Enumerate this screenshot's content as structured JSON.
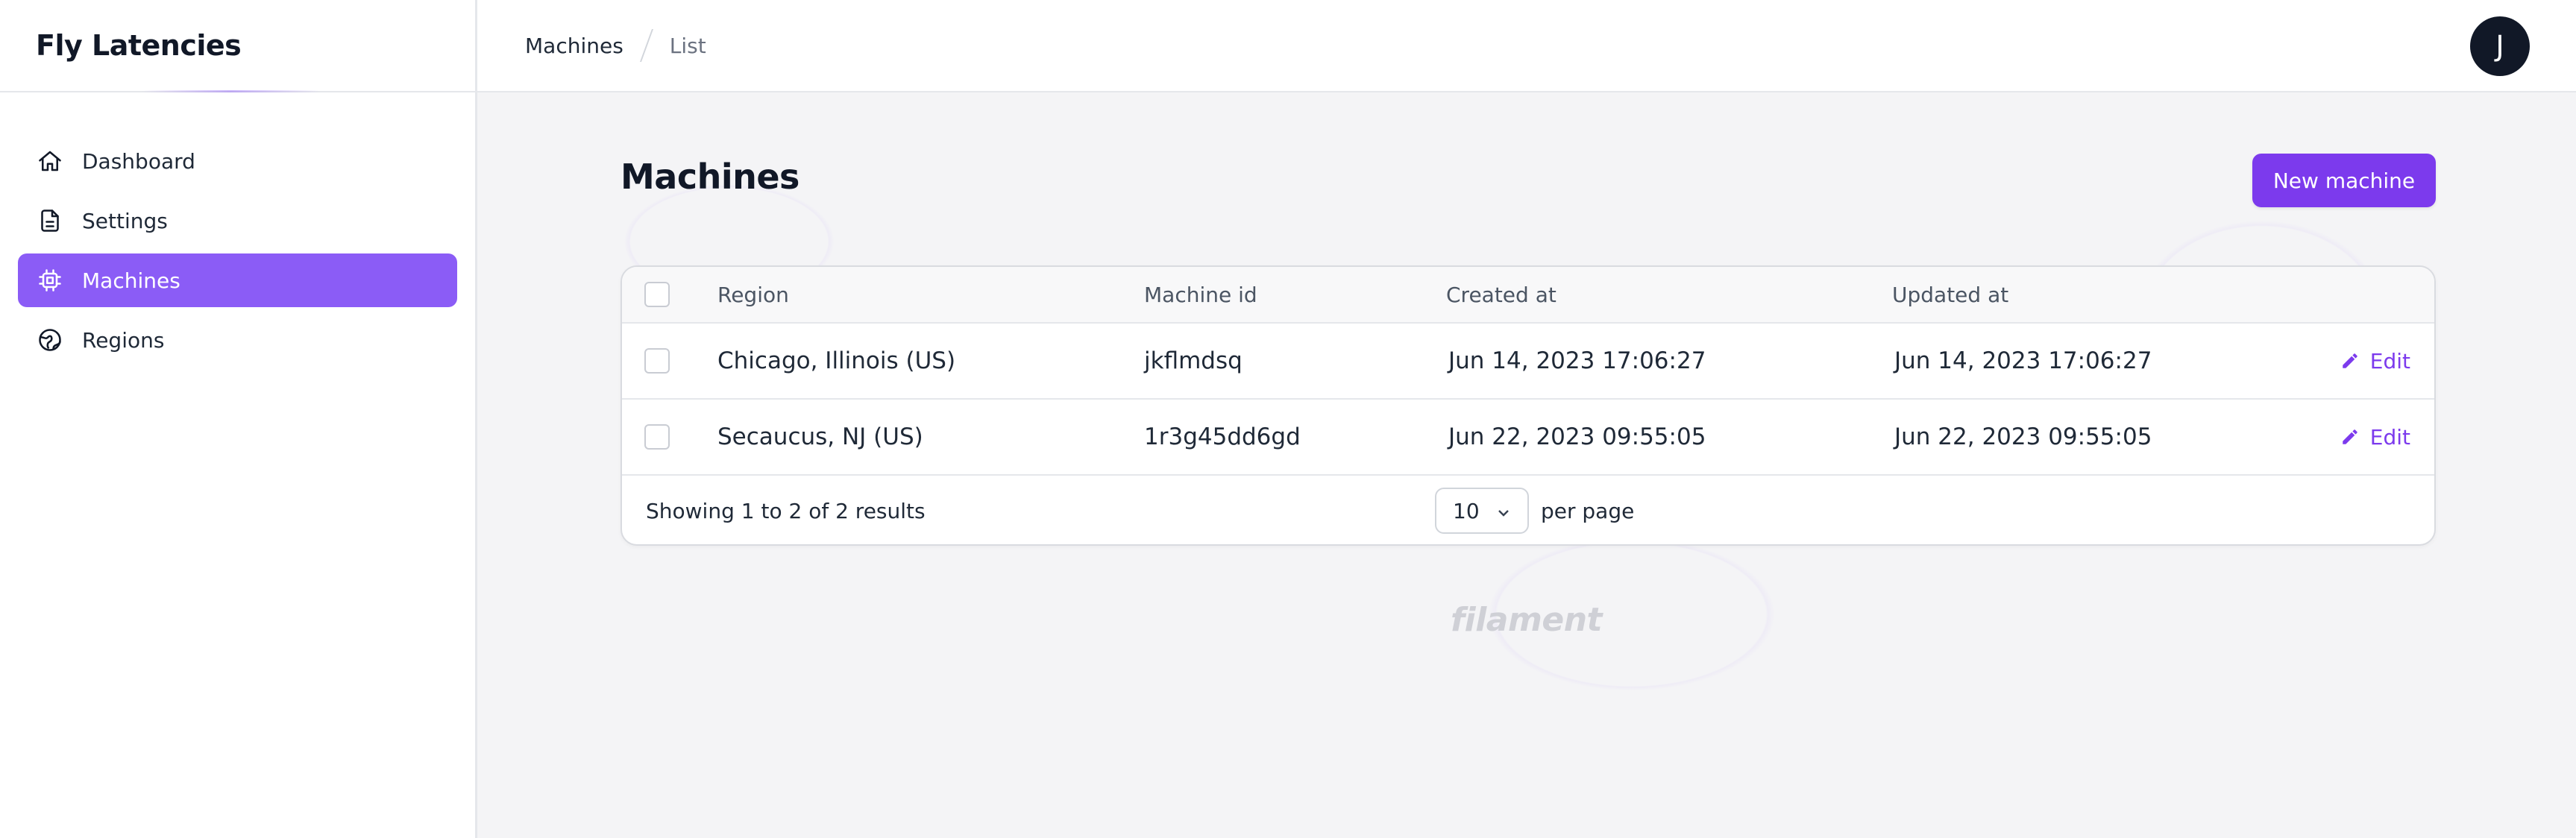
{
  "sidebar": {
    "brand": "Fly Latencies",
    "items": [
      {
        "label": "Dashboard",
        "icon": "home-icon",
        "active": false
      },
      {
        "label": "Settings",
        "icon": "document-icon",
        "active": false
      },
      {
        "label": "Machines",
        "icon": "cpu-chip-icon",
        "active": true
      },
      {
        "label": "Regions",
        "icon": "globe-icon",
        "active": false
      }
    ]
  },
  "topbar": {
    "breadcrumb": [
      "Machines",
      "List"
    ],
    "avatar_initial": "J"
  },
  "main": {
    "title": "Machines",
    "new_button": "New machine",
    "table": {
      "columns": [
        "Region",
        "Machine id",
        "Created at",
        "Updated at"
      ],
      "rows": [
        {
          "region": "Chicago, Illinois (US)",
          "machine_id": "jkflmdsq",
          "created_at": "Jun 14, 2023 17:06:27",
          "updated_at": "Jun 14, 2023 17:06:27",
          "action": "Edit"
        },
        {
          "region": "Secaucus, NJ (US)",
          "machine_id": "1r3g45dd6gd",
          "created_at": "Jun 22, 2023 09:55:05",
          "updated_at": "Jun 22, 2023 09:55:05",
          "action": "Edit"
        }
      ],
      "footer": {
        "showing": "Showing 1 to 2 of 2 results",
        "per_page_value": "10",
        "per_page_label": "per page"
      }
    },
    "footer_logo": "filament"
  },
  "colors": {
    "accent": "#8b5cf6",
    "primary_button": "#7c3aed",
    "avatar_bg": "#111827"
  }
}
